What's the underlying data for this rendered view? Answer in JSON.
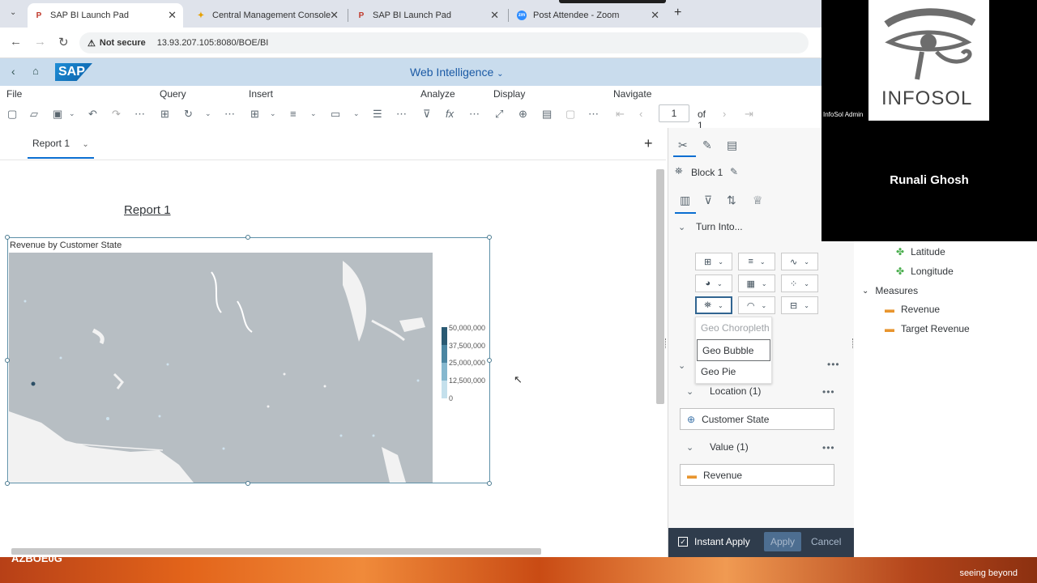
{
  "browser": {
    "tabs": [
      {
        "title": "SAP BI Launch Pad",
        "fav": "P"
      },
      {
        "title": "Central Management Console",
        "fav": "✦"
      },
      {
        "title": "SAP BI Launch Pad",
        "fav": "P"
      },
      {
        "title": "Post Attendee - Zoom",
        "fav": "zm"
      }
    ],
    "security_label": "Not secure",
    "url": "13.93.207.105:8080/BOE/BI"
  },
  "shell": {
    "logo": "SAP",
    "app_title": "Web Intelligence"
  },
  "toolbar": {
    "groups": {
      "file": "File",
      "query": "Query",
      "insert": "Insert",
      "analyze": "Analyze",
      "display": "Display",
      "navigate": "Navigate"
    },
    "page_value": "1",
    "page_of": "of 1"
  },
  "report_tabs": {
    "active": "Report 1"
  },
  "canvas": {
    "report_title": "Report 1",
    "chart_title": "Revenue by Customer State",
    "legend_ticks": [
      "50,000,000",
      "37,500,000",
      "25,000,000",
      "12,500,000",
      "0"
    ]
  },
  "side_panel": {
    "block_name": "Block 1",
    "turn_into": "Turn Into...",
    "dropdown": [
      {
        "label": "Geo Choropleth",
        "state": "disabled"
      },
      {
        "label": "Geo Bubble",
        "state": "focus"
      },
      {
        "label": "Geo Pie",
        "state": "normal"
      }
    ],
    "location_section": "Location (1)",
    "location_field": "Customer State",
    "value_section": "Value (1)",
    "value_field": "Revenue",
    "instant_apply": "Instant Apply",
    "apply": "Apply",
    "cancel": "Cancel"
  },
  "data_panel": {
    "items": [
      "Latitude",
      "Longitude"
    ],
    "measures_label": "Measures",
    "measures": [
      "Revenue",
      "Target Revenue"
    ]
  },
  "video": {
    "logo_text": "INFOSOL",
    "admin_label": "InfoSol Admin",
    "participant": "Runali Ghosh"
  },
  "banner": {
    "left_text": "AZBOE0G",
    "right_text": "seeing beyond"
  }
}
